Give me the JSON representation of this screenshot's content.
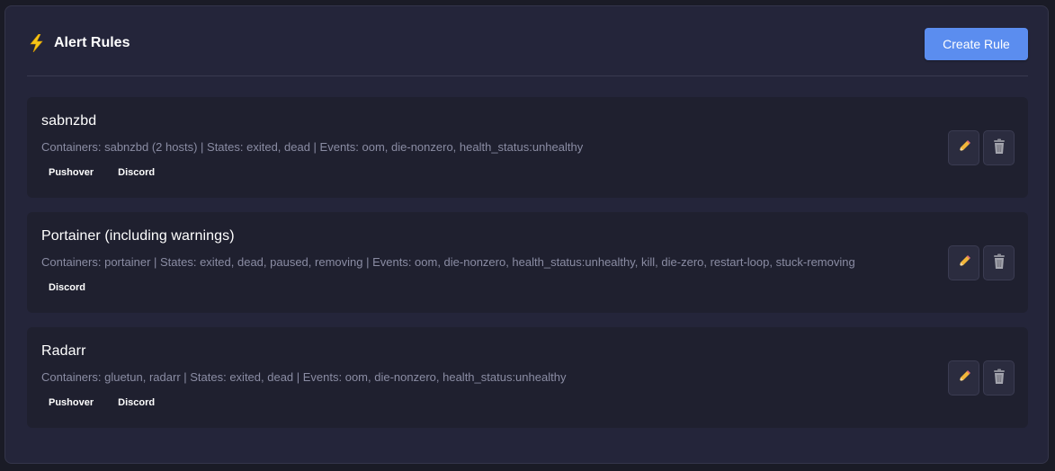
{
  "header": {
    "icon": "lightning-bolt-icon",
    "title": "Alert Rules",
    "create_label": "Create Rule"
  },
  "colors": {
    "accent": "#5b8def",
    "background": "#24253a",
    "card": "#1f202f",
    "muted_text": "#8a8ca3"
  },
  "rules": [
    {
      "name": "sabnzbd",
      "details": "Containers: sabnzbd (2 hosts) | States: exited, dead | Events: oom, die-nonzero, health_status:unhealthy",
      "channels": [
        "Pushover",
        "Discord"
      ]
    },
    {
      "name": "Portainer (including warnings)",
      "details": "Containers: portainer | States: exited, dead, paused, removing | Events: oom, die-nonzero, health_status:unhealthy, kill, die-zero, restart-loop, stuck-removing",
      "channels": [
        "Discord"
      ]
    },
    {
      "name": "Radarr",
      "details": "Containers: gluetun, radarr | States: exited, dead | Events: oom, die-nonzero, health_status:unhealthy",
      "channels": [
        "Pushover",
        "Discord"
      ]
    }
  ],
  "actions": {
    "edit_icon": "pencil-icon",
    "delete_icon": "trash-icon"
  }
}
